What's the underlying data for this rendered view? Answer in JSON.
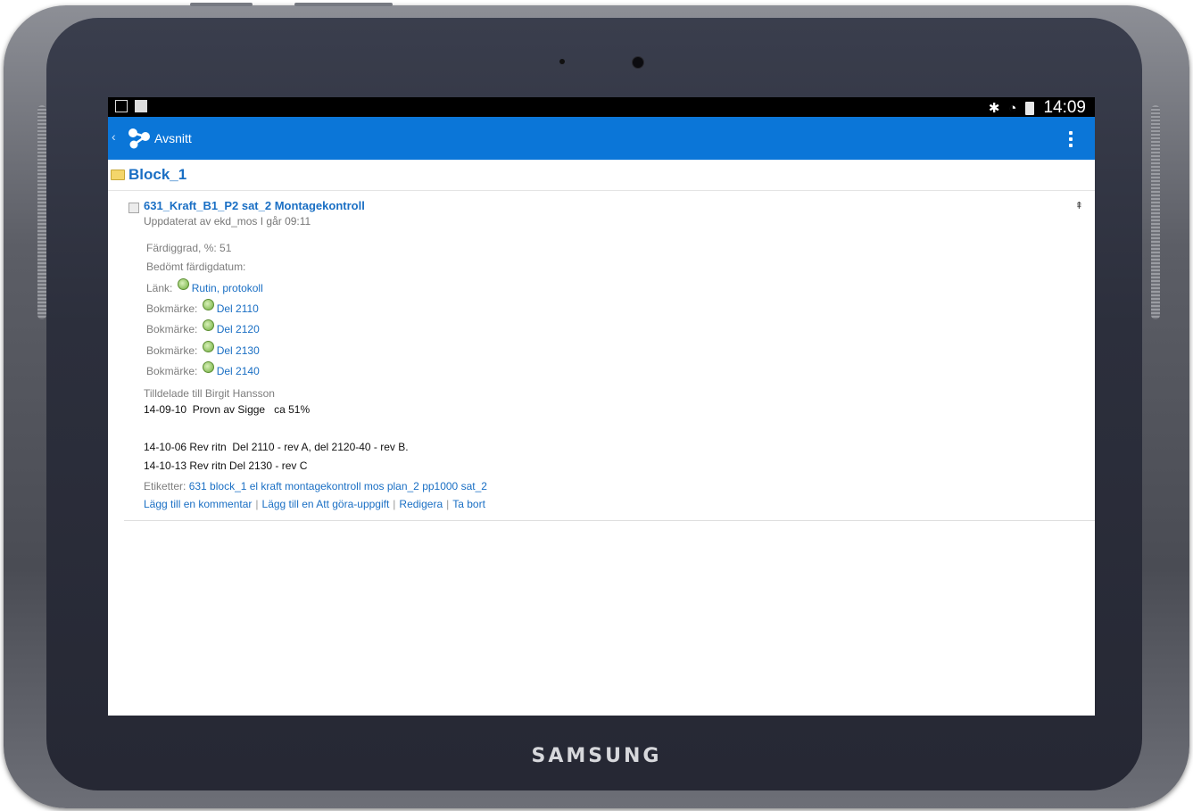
{
  "device": {
    "brand": "SAMSUNG"
  },
  "statusbar": {
    "time": "14:09"
  },
  "actionbar": {
    "back": "‹",
    "title": "Avsnitt"
  },
  "folder": {
    "name": "Block_1"
  },
  "item": {
    "title": "631_Kraft_B1_P2 sat_2 Montagekontroll",
    "updated": "Uppdaterat av ekd_mos I går 09:11",
    "fields": {
      "fardiggrad": "Färdiggrad, %: 51",
      "bedomt": "Bedömt färdigdatum:",
      "link_label": "Länk:",
      "link_text": "Rutin, protokoll",
      "bookmarks": [
        {
          "label": "Bokmärke:",
          "text": "Del 2110"
        },
        {
          "label": "Bokmärke:",
          "text": "Del 2120"
        },
        {
          "label": "Bokmärke:",
          "text": "Del 2130"
        },
        {
          "label": "Bokmärke:",
          "text": "Del 2140"
        }
      ]
    },
    "assigned": "Tilldelade till Birgit Hansson",
    "notes": [
      "14-09-10  Provn av Sigge   ca 51%",
      "14-10-06 Rev ritn  Del 2110 - rev A, del 2120-40 - rev B.",
      "14-10-13 Rev ritn Del 2130 - rev C"
    ],
    "tags_label": "Etiketter:",
    "tags": "631 block_1 el kraft montagekontroll mos plan_2 pp1000 sat_2",
    "actions": {
      "comment": "Lägg till en kommentar",
      "todo": "Lägg till en Att göra-uppgift",
      "edit": "Redigera",
      "delete": "Ta bort"
    }
  },
  "colors": {
    "accent": "#0b76d8",
    "link": "#1a6fc4"
  }
}
